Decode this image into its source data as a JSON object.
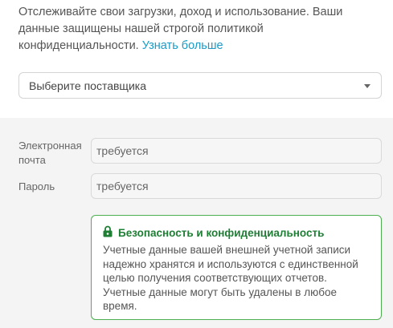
{
  "intro": {
    "text": "Отслеживайте свои загрузки, доход и использование. Ваши данные защищены нашей строгой политикой конфиденциальности.",
    "link_label": "Узнать больше"
  },
  "provider_select": {
    "selected": "Выберите поставщика"
  },
  "form": {
    "email_label": "Электронная почта",
    "email_placeholder": "требуется",
    "password_label": "Пароль",
    "password_placeholder": "требуется"
  },
  "security_notice": {
    "icon": "lock-icon",
    "title": "Безопасность и конфиденциальность",
    "body": "Учетные данные вашей внешней учетной записи надежно хранятся и используются с единственной целью получения соответствующих отчетов. Учетные данные могут быть удалены в любое время."
  },
  "colors": {
    "link": "#1a9bc7",
    "notice_green": "#1e7e34",
    "notice_border": "#4caf50",
    "panel_bg": "#f4f4f4"
  }
}
